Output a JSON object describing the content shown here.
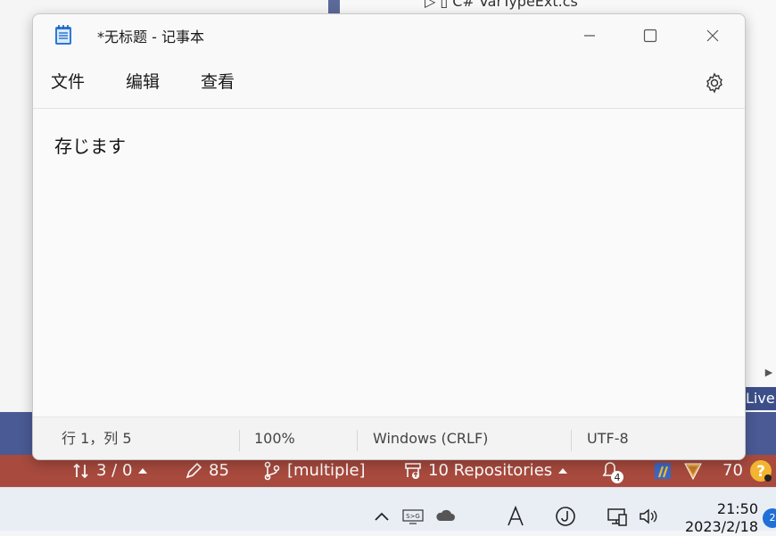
{
  "background": {
    "tree_item": "▷ ▯ C# VarTypeExt.cs",
    "live_label": "Live"
  },
  "notepad": {
    "title": "*无标题 - 记事本",
    "menu": [
      "文件",
      "编辑",
      "查看"
    ],
    "content": "存じます",
    "status": {
      "position": "行 1，列 5",
      "zoom": "100%",
      "line_ending": "Windows (CRLF)",
      "encoding": "UTF-8"
    }
  },
  "ide_status": {
    "sync": "3 / 0",
    "edits": "85",
    "branch": "[multiple]",
    "repos": "10 Repositories",
    "notifications": "4",
    "count": "70"
  },
  "taskbar": {
    "time": "21:50",
    "date": "2023/2/18",
    "badge": "2"
  },
  "colors": {
    "status_red": "#a84a3e",
    "ide_blue": "#4a5a94",
    "accent": "#1e6fd8"
  }
}
